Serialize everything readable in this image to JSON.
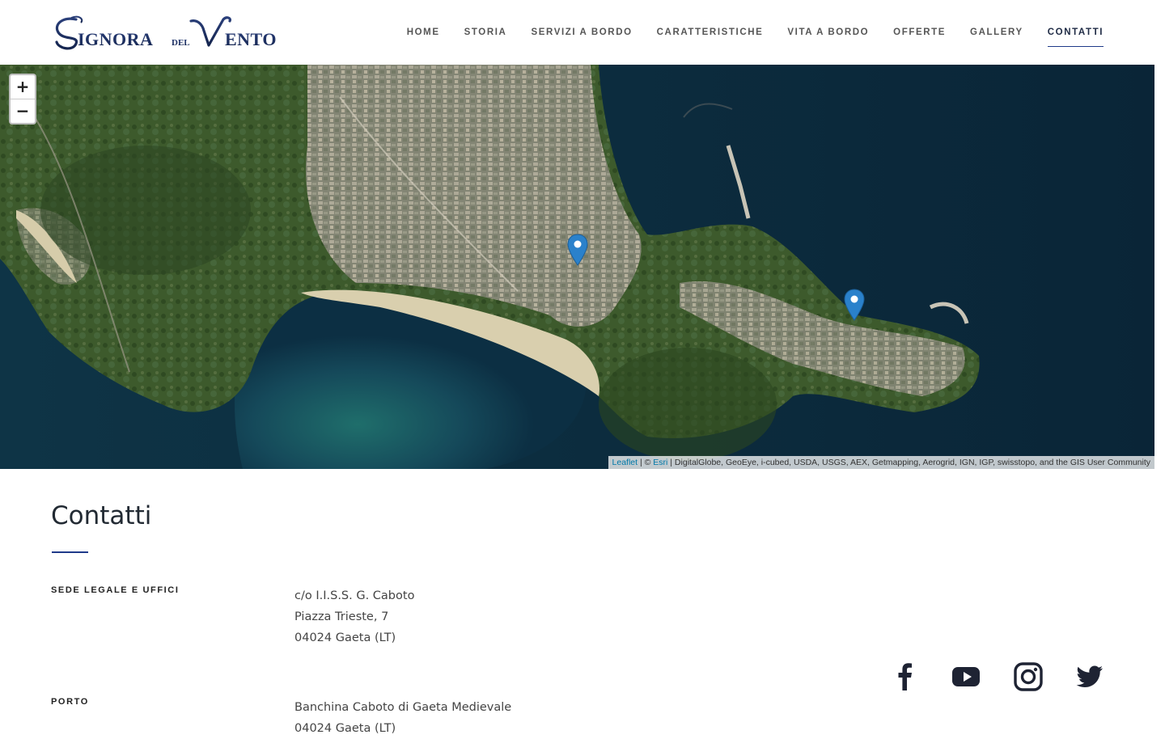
{
  "brand": {
    "logo_text": "Signora del Vento"
  },
  "nav": {
    "items": [
      "HOME",
      "STORIA",
      "SERVIZI A BORDO",
      "CARATTERISTICHE",
      "VITA A BORDO",
      "OFFERTE",
      "GALLERY",
      "CONTATTI"
    ],
    "active": "CONTATTI"
  },
  "map": {
    "zoom_in": "+",
    "zoom_out": "−",
    "attribution": {
      "leaflet": "Leaflet",
      "sep": " | © ",
      "esri": "Esri",
      "rest": " | DigitalGlobe, GeoEye, i-cubed, USDA, USGS, AEX, Getmapping, Aerogrid, IGN, IGP, swisstopo, and the GIS User Community"
    },
    "marker_color": "#2a81cb"
  },
  "contact": {
    "title": "Contatti",
    "sections": [
      {
        "label": "SEDE LEGALE E UFFICI",
        "lines": [
          "c/o I.I.S.S. G. Caboto",
          "Piazza Trieste, 7",
          "04024 Gaeta (LT)"
        ]
      },
      {
        "label": "PORTO",
        "lines": [
          "Banchina Caboto di Gaeta Medievale",
          "04024 Gaeta (LT)"
        ]
      }
    ]
  },
  "social": [
    "facebook-icon",
    "youtube-icon",
    "instagram-icon",
    "twitter-icon"
  ],
  "colors": {
    "accent": "#1f3a8a",
    "text_dark": "#222a33",
    "icon": "#1e2333"
  }
}
